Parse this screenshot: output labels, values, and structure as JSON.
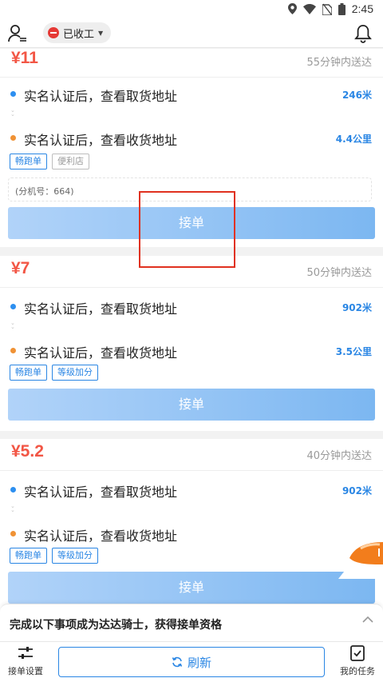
{
  "status_bar": {
    "time": "2:45"
  },
  "header": {
    "work_status": "已收工"
  },
  "orders": [
    {
      "price": "¥11",
      "eta": "55分钟内送达",
      "pickup_text": "实名认证后，查看取货地址",
      "pickup_distance": "246米",
      "dropoff_text": "实名认证后，查看收货地址",
      "dropoff_distance": "4.4公里",
      "tags": [
        "畅跑单",
        "便利店"
      ],
      "note": "(分机号：664)",
      "accept_label": "接单"
    },
    {
      "price": "¥7",
      "eta": "50分钟内送达",
      "pickup_text": "实名认证后，查看取货地址",
      "pickup_distance": "902米",
      "dropoff_text": "实名认证后，查看收货地址",
      "dropoff_distance": "3.5公里",
      "tags": [
        "畅跑单",
        "等级加分"
      ],
      "accept_label": "接单"
    },
    {
      "price": "¥5.2",
      "eta": "40分钟内送达",
      "pickup_text": "实名认证后，查看取货地址",
      "pickup_distance": "902米",
      "dropoff_text": "实名认证后，查看收货地址",
      "dropoff_distance": "",
      "tags": [
        "畅跑单",
        "等级加分"
      ],
      "accept_label": "接单"
    }
  ],
  "task_panel": {
    "title": "完成以下事项成为达达骑士，获得接单资格"
  },
  "bottom_bar": {
    "settings_label": "接单设置",
    "refresh_label": "刷新",
    "tasks_label": "我的任务"
  },
  "colors": {
    "price": "#f25645",
    "accent": "#2a86e4",
    "pickup_dot": "#2d8ff0",
    "dropoff_dot": "#f09235",
    "stop": "#e53935"
  }
}
